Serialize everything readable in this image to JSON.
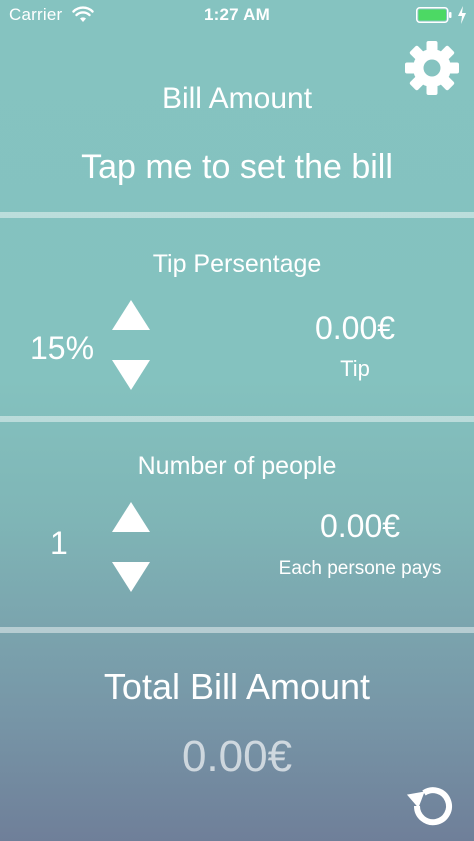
{
  "status_bar": {
    "carrier": "Carrier",
    "time": "1:27 AM",
    "battery_color": "#4cd964",
    "icons": [
      "wifi-icon",
      "battery-icon",
      "charging-bolt-icon"
    ]
  },
  "header": {
    "settings_icon": "gear-icon"
  },
  "bill": {
    "title": "Bill Amount",
    "tap_label": "Tap me to set the bill"
  },
  "tip": {
    "title": "Tip Persentage",
    "percentage": "15%",
    "amount": "0.00€",
    "amount_label": "Tip",
    "up_icon": "triangle-up-icon",
    "down_icon": "triangle-down-icon"
  },
  "people": {
    "title": "Number of people",
    "count": "1",
    "amount": "0.00€",
    "amount_label": "Each persone pays",
    "up_icon": "triangle-up-icon",
    "down_icon": "triangle-down-icon"
  },
  "total": {
    "title": "Total Bill Amount",
    "amount": "0.00€",
    "reset_icon": "refresh-icon"
  },
  "colors": {
    "background_top": "#85c3c0",
    "background_bottom": "#6f7f99",
    "text": "#ffffff"
  }
}
